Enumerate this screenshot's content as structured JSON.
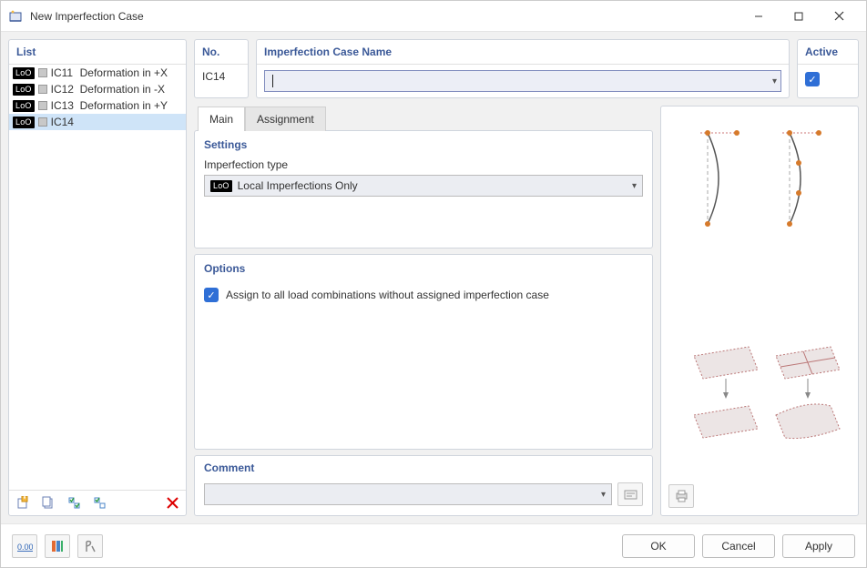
{
  "window": {
    "title": "New Imperfection Case"
  },
  "list": {
    "title": "List",
    "badge_label": "LoO",
    "items": [
      {
        "id": "IC11",
        "name": "Deformation in +X",
        "selected": false
      },
      {
        "id": "IC12",
        "name": "Deformation in -X",
        "selected": false
      },
      {
        "id": "IC13",
        "name": "Deformation in +Y",
        "selected": false
      },
      {
        "id": "IC14",
        "name": "IC14",
        "selected": true
      }
    ]
  },
  "no": {
    "title": "No.",
    "value": "IC14"
  },
  "name_field": {
    "title": "Imperfection Case Name",
    "value": ""
  },
  "active": {
    "title": "Active",
    "checked": true
  },
  "tabs": {
    "main": "Main",
    "assignment": "Assignment"
  },
  "settings": {
    "title": "Settings",
    "type_label": "Imperfection type",
    "type_badge": "LoO",
    "type_value": "Local Imperfections Only"
  },
  "options": {
    "title": "Options",
    "assign_all": "Assign to all load combinations without assigned imperfection case",
    "assign_all_checked": true
  },
  "comment": {
    "title": "Comment",
    "value": ""
  },
  "buttons": {
    "ok": "OK",
    "cancel": "Cancel",
    "apply": "Apply"
  }
}
